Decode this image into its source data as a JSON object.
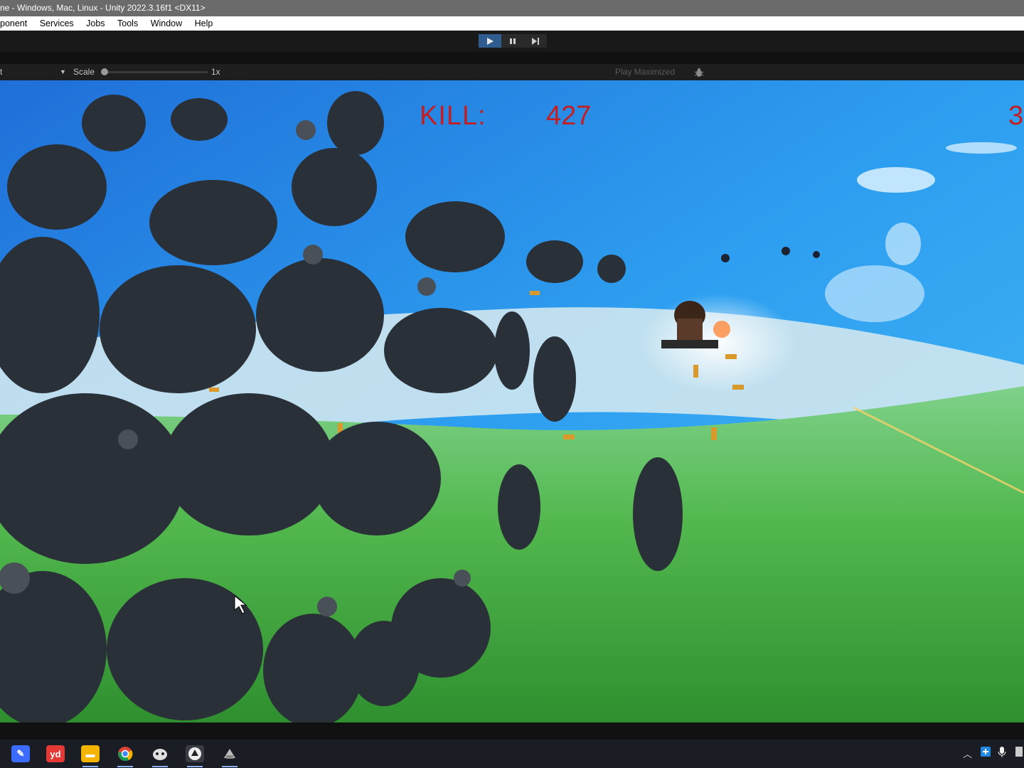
{
  "window": {
    "title": "ne - Windows, Mac, Linux - Unity 2022.3.16f1 <DX11>"
  },
  "menu": {
    "items": [
      {
        "label": "ponent",
        "name": "menu-component"
      },
      {
        "label": "Services",
        "name": "menu-services"
      },
      {
        "label": "Jobs",
        "name": "menu-jobs"
      },
      {
        "label": "Tools",
        "name": "menu-tools"
      },
      {
        "label": "Window",
        "name": "menu-window"
      },
      {
        "label": "Help",
        "name": "menu-help"
      }
    ]
  },
  "toolbar": {
    "play_icon": "play-icon",
    "pause_icon": "pause-icon",
    "step_icon": "step-icon",
    "play_active": true,
    "accent": "#2f5d8f"
  },
  "game_view": {
    "display_label": "t",
    "scale_label": "Scale",
    "scale_value": "1x",
    "scale_fraction": 0.0,
    "play_mode_label": "Play Maximized",
    "debug_icon": "bug-icon"
  },
  "hud": {
    "kill_label": "KILL:",
    "kill_value": "427",
    "right_value": "3",
    "color": "#c41e22"
  },
  "taskbar": {
    "apps": [
      {
        "name": "notes-app-icon",
        "color": "#3b6cff",
        "glyph": "✎"
      },
      {
        "name": "youdao-icon",
        "color": "#e53935",
        "glyph": "yd"
      },
      {
        "name": "file-explorer-icon",
        "color": "#f4b400",
        "glyph": "▬"
      },
      {
        "name": "chrome-icon",
        "color": "#db4437",
        "glyph": "●"
      },
      {
        "name": "unity-hub-icon",
        "color": "#555",
        "glyph": "◆"
      },
      {
        "name": "unity-editor-icon",
        "color": "#444",
        "glyph": "◈"
      },
      {
        "name": "game-app-icon",
        "color": "#666",
        "glyph": "▲"
      }
    ],
    "tray": {
      "chevron_icon": "chevron-up-icon",
      "app_icon": "tray-app-icon",
      "mic_icon": "microphone-icon"
    }
  }
}
